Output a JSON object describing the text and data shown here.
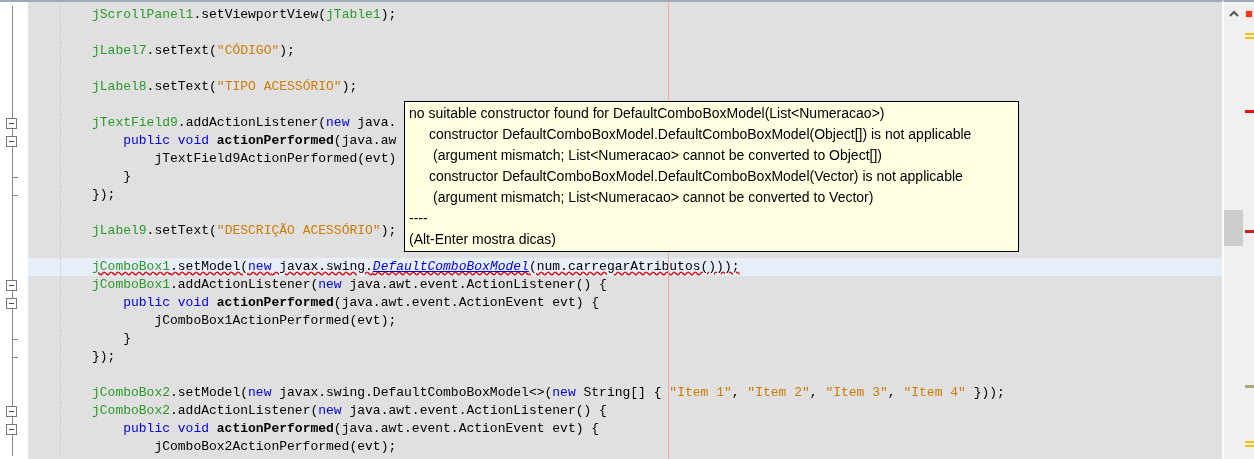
{
  "editor": {
    "lines": [
      {
        "kind": "code",
        "segments": [
          {
            "kind": "field",
            "text": "jScrollPanel1"
          },
          {
            "kind": "plain",
            "text": ".setViewportView("
          },
          {
            "kind": "field",
            "text": "jTable1"
          },
          {
            "kind": "plain",
            "text": ");"
          }
        ]
      },
      {
        "kind": "blank"
      },
      {
        "kind": "code",
        "segments": [
          {
            "kind": "field",
            "text": "jLabel7"
          },
          {
            "kind": "plain",
            "text": ".setText("
          },
          {
            "kind": "string",
            "text": "\"CÓDIGO\""
          },
          {
            "kind": "plain",
            "text": ");"
          }
        ]
      },
      {
        "kind": "blank"
      },
      {
        "kind": "code",
        "segments": [
          {
            "kind": "field",
            "text": "jLabel8"
          },
          {
            "kind": "plain",
            "text": ".setText("
          },
          {
            "kind": "string",
            "text": "\"TIPO ACESSÓRIO\""
          },
          {
            "kind": "plain",
            "text": ");"
          }
        ]
      },
      {
        "kind": "blank"
      },
      {
        "kind": "fold_start",
        "segments": [
          {
            "kind": "field",
            "text": "jTextField9"
          },
          {
            "kind": "plain",
            "text": ".addActionListener("
          },
          {
            "kind": "keyword",
            "text": "new"
          },
          {
            "kind": "plain",
            "text": " java."
          }
        ],
        "children": [
          {
            "kind": "fold_start",
            "segments": [
              {
                "kind": "keyword",
                "text": "public void "
              },
              {
                "kind": "method",
                "text": "actionPerformed"
              },
              {
                "kind": "plain",
                "text": "(java.aw"
              }
            ],
            "children": [
              {
                "kind": "code",
                "segments": [
                  {
                    "kind": "plain",
                    "text": "jTextField9ActionPerformed(evt)"
                  }
                ]
              }
            ]
          },
          {
            "kind": "fold_end",
            "segments": [
              {
                "kind": "plain",
                "text": "}"
              }
            ]
          }
        ]
      },
      {
        "kind": "fold_end",
        "segments": [
          {
            "kind": "plain",
            "text": "});"
          }
        ]
      },
      {
        "kind": "blank"
      },
      {
        "kind": "code",
        "segments": [
          {
            "kind": "field",
            "text": "jLabel9"
          },
          {
            "kind": "plain",
            "text": ".setText("
          },
          {
            "kind": "string",
            "text": "\"DESCRIÇÃO ACESSÓRIO\""
          },
          {
            "kind": "plain",
            "text": ");"
          }
        ]
      },
      {
        "kind": "blank"
      },
      {
        "kind": "code",
        "current": true,
        "error": true,
        "segments": [
          {
            "kind": "field",
            "text": "jComboBox1"
          },
          {
            "kind": "plain",
            "text": ".setModel("
          },
          {
            "kind": "keyword",
            "text": "new"
          },
          {
            "kind": "plain",
            "text": " javax.swing."
          },
          {
            "kind": "link",
            "text": "DefaultComboBoxModel"
          },
          {
            "kind": "plain",
            "text": "(num.carregarAtributos()));"
          }
        ]
      },
      {
        "kind": "fold_start",
        "segments": [
          {
            "kind": "field",
            "text": "jComboBox1"
          },
          {
            "kind": "plain",
            "text": ".addActionListener("
          },
          {
            "kind": "keyword",
            "text": "new"
          },
          {
            "kind": "plain",
            "text": " java.awt.event.ActionListener() {"
          }
        ],
        "children": [
          {
            "kind": "fold_start",
            "segments": [
              {
                "kind": "keyword",
                "text": "public void "
              },
              {
                "kind": "method",
                "text": "actionPerformed"
              },
              {
                "kind": "plain",
                "text": "(java.awt.event.ActionEvent evt) {"
              }
            ],
            "children": [
              {
                "kind": "code",
                "segments": [
                  {
                    "kind": "plain",
                    "text": "jComboBox1ActionPerformed(evt);"
                  }
                ]
              }
            ]
          },
          {
            "kind": "fold_end",
            "segments": [
              {
                "kind": "plain",
                "text": "}"
              }
            ]
          }
        ]
      },
      {
        "kind": "fold_end",
        "segments": [
          {
            "kind": "plain",
            "text": "});"
          }
        ]
      },
      {
        "kind": "blank"
      },
      {
        "kind": "code",
        "segments": [
          {
            "kind": "field",
            "text": "jComboBox2"
          },
          {
            "kind": "plain",
            "text": ".setModel("
          },
          {
            "kind": "keyword",
            "text": "new"
          },
          {
            "kind": "plain",
            "text": " javax.swing.DefaultComboBoxModel<>("
          },
          {
            "kind": "keyword",
            "text": "new"
          },
          {
            "kind": "plain",
            "text": " String[] { "
          },
          {
            "kind": "string",
            "text": "\"Item 1\""
          },
          {
            "kind": "plain",
            "text": ", "
          },
          {
            "kind": "string",
            "text": "\"Item 2\""
          },
          {
            "kind": "plain",
            "text": ", "
          },
          {
            "kind": "string",
            "text": "\"Item 3\""
          },
          {
            "kind": "plain",
            "text": ", "
          },
          {
            "kind": "string",
            "text": "\"Item 4\""
          },
          {
            "kind": "plain",
            "text": " }));"
          }
        ]
      },
      {
        "kind": "fold_start",
        "segments": [
          {
            "kind": "field",
            "text": "jComboBox2"
          },
          {
            "kind": "plain",
            "text": ".addActionListener("
          },
          {
            "kind": "keyword",
            "text": "new"
          },
          {
            "kind": "plain",
            "text": " java.awt.event.ActionListener() {"
          }
        ],
        "children": [
          {
            "kind": "fold_start",
            "segments": [
              {
                "kind": "keyword",
                "text": "public void "
              },
              {
                "kind": "method",
                "text": "actionPerformed"
              },
              {
                "kind": "plain",
                "text": "(java.awt.event.ActionEvent evt) {"
              }
            ],
            "children": [
              {
                "kind": "code",
                "segments": [
                  {
                    "kind": "plain",
                    "text": "jComboBox2ActionPerformed(evt);"
                  }
                ]
              }
            ]
          }
        ]
      }
    ]
  },
  "tooltip": {
    "lines": [
      {
        "text": "no suitable constructor found for DefaultComboBoxModel(List<Numeracao>)",
        "children": [
          {
            "text": "constructor DefaultComboBoxModel.DefaultComboBoxModel(Object[]) is not applicable",
            "children": [
              {
                "text": "(argument mismatch; List<Numeracao> cannot be converted to Object[])"
              }
            ]
          },
          {
            "text": "constructor DefaultComboBoxModel.DefaultComboBoxModel(Vector) is not applicable",
            "children": [
              {
                "text": "(argument mismatch; List<Numeracao> cannot be converted to Vector)"
              }
            ]
          }
        ]
      },
      {
        "text": "----"
      },
      {
        "text": "(Alt-Enter mostra dicas)"
      }
    ]
  }
}
